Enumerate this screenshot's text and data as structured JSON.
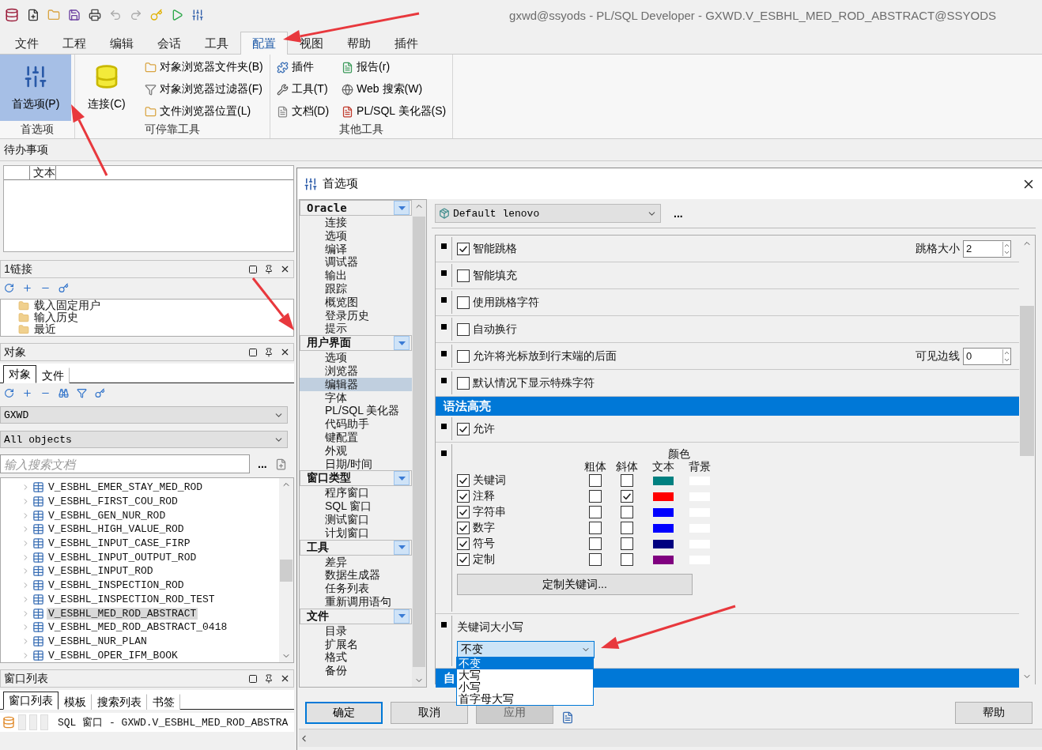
{
  "app": {
    "title": "gxwd@ssyods - PL/SQL Developer - GXWD.V_ESBHL_MED_ROD_ABSTRACT@SSYODS"
  },
  "menu_tabs": [
    {
      "label": "文件",
      "selected": false
    },
    {
      "label": "工程",
      "selected": false
    },
    {
      "label": "编辑",
      "selected": false
    },
    {
      "label": "会话",
      "selected": false
    },
    {
      "label": "工具",
      "selected": false
    },
    {
      "label": "配置",
      "selected": true
    },
    {
      "label": "视图",
      "selected": false
    },
    {
      "label": "帮助",
      "selected": false
    },
    {
      "label": "插件",
      "selected": false
    }
  ],
  "ribbon": {
    "groups": [
      {
        "label": "首选项",
        "large": [
          {
            "label": "首选项(P)",
            "selected": true
          }
        ]
      },
      {
        "label": "可停靠工具",
        "large": [
          {
            "label": "连接(C)",
            "selected": false
          }
        ],
        "small": [
          "对象浏览器文件夹(B)",
          "对象浏览器过滤器(F)",
          "文件浏览器位置(L)"
        ]
      },
      {
        "label": "其他工具",
        "small": [
          "插件",
          "工具(T)",
          "文档(D)",
          "报告(r)",
          "Web 搜索(W)",
          "PL/SQL 美化器(S)"
        ]
      }
    ]
  },
  "todo": {
    "title": "待办事项",
    "columns": [
      "文本"
    ]
  },
  "connections": {
    "title": "1链接",
    "tree": [
      "载入固定用户",
      "输入历史",
      "最近"
    ]
  },
  "objects": {
    "title": "对象",
    "tabs": [
      {
        "label": "对象",
        "selected": true
      },
      {
        "label": "文件",
        "selected": false
      }
    ],
    "user": "GXWD",
    "filter": "All objects",
    "search": {
      "placeholder": "输入搜索文档"
    },
    "more": "...",
    "items": [
      {
        "label": "V_ESBHL_EMER_STAY_MED_ROD",
        "selected": false
      },
      {
        "label": "V_ESBHL_FIRST_COU_ROD",
        "selected": false
      },
      {
        "label": "V_ESBHL_GEN_NUR_ROD",
        "selected": false
      },
      {
        "label": "V_ESBHL_HIGH_VALUE_ROD",
        "selected": false
      },
      {
        "label": "V_ESBHL_INPUT_CASE_FIRP",
        "selected": false
      },
      {
        "label": "V_ESBHL_INPUT_OUTPUT_ROD",
        "selected": false
      },
      {
        "label": "V_ESBHL_INPUT_ROD",
        "selected": false
      },
      {
        "label": "V_ESBHL_INSPECTION_ROD",
        "selected": false
      },
      {
        "label": "V_ESBHL_INSPECTION_ROD_TEST",
        "selected": false
      },
      {
        "label": "V_ESBHL_MED_ROD_ABSTRACT",
        "selected": true
      },
      {
        "label": "V_ESBHL_MED_ROD_ABSTRACT_0418",
        "selected": false
      },
      {
        "label": "V_ESBHL_NUR_PLAN",
        "selected": false
      },
      {
        "label": "V_ESBHL_OPER_IFM_BOOK",
        "selected": false
      }
    ]
  },
  "window_list": {
    "title": "窗口列表",
    "tabs": [
      {
        "label": "窗口列表",
        "selected": true
      },
      {
        "label": "模板",
        "selected": false
      },
      {
        "label": "搜索列表",
        "selected": false
      },
      {
        "label": "书签",
        "selected": false
      }
    ],
    "items": [
      "SQL 窗口 - GXWD.V_ESBHL_MED_ROD_ABSTRA"
    ]
  },
  "dialog": {
    "title": "首选项",
    "categories": [
      {
        "label": "Oracle",
        "items": [
          {
            "label": "连接",
            "selected": false
          },
          {
            "label": "选项",
            "selected": false
          },
          {
            "label": "编译",
            "selected": false
          },
          {
            "label": "调试器",
            "selected": false
          },
          {
            "label": "输出",
            "selected": false
          },
          {
            "label": "跟踪",
            "selected": false
          },
          {
            "label": "概览图",
            "selected": false
          },
          {
            "label": "登录历史",
            "selected": false
          },
          {
            "label": "提示",
            "selected": false
          }
        ]
      },
      {
        "label": "用户界面",
        "items": [
          {
            "label": "选项",
            "selected": false
          },
          {
            "label": "浏览器",
            "selected": false
          },
          {
            "label": "编辑器",
            "selected": true
          },
          {
            "label": "字体",
            "selected": false
          },
          {
            "label": "PL/SQL 美化器",
            "selected": false
          },
          {
            "label": "代码助手",
            "selected": false
          },
          {
            "label": "键配置",
            "selected": false
          },
          {
            "label": "外观",
            "selected": false
          },
          {
            "label": "日期/时间",
            "selected": false
          }
        ]
      },
      {
        "label": "窗口类型",
        "items": [
          {
            "label": "程序窗口",
            "selected": false
          },
          {
            "label": "SQL 窗口",
            "selected": false
          },
          {
            "label": "测试窗口",
            "selected": false
          },
          {
            "label": "计划窗口",
            "selected": false
          }
        ]
      },
      {
        "label": "工具",
        "items": [
          {
            "label": "差异",
            "selected": false
          },
          {
            "label": "数据生成器",
            "selected": false
          },
          {
            "label": "任务列表",
            "selected": false
          },
          {
            "label": "重新调用语句",
            "selected": false
          }
        ]
      },
      {
        "label": "文件",
        "items": [
          {
            "label": "目录",
            "selected": false
          },
          {
            "label": "扩展名",
            "selected": false
          },
          {
            "label": "格式",
            "selected": false
          },
          {
            "label": "备份",
            "selected": false
          }
        ]
      }
    ],
    "profile": "Default lenovo",
    "profile_more": "...",
    "rows": [
      {
        "kind": "option",
        "label": "智能跳格",
        "checked": true,
        "spin": {
          "label": "跳格大小",
          "value": "2"
        }
      },
      {
        "kind": "option",
        "label": "智能填充",
        "checked": false
      },
      {
        "kind": "option",
        "label": "使用跳格字符",
        "checked": false
      },
      {
        "kind": "option",
        "label": "自动换行",
        "checked": false
      },
      {
        "kind": "option",
        "label": "允许将光标放到行末端的后面",
        "checked": false,
        "spin": {
          "label": "可见边线",
          "value": "0"
        }
      },
      {
        "kind": "option",
        "label": "默认情况下显示特殊字符",
        "checked": false
      },
      {
        "kind": "header",
        "label": "语法高亮"
      },
      {
        "kind": "option",
        "label": "允许",
        "checked": true
      },
      {
        "kind": "syntax",
        "headers": {
          "bold_label": "粗体",
          "italic_label": "斜体",
          "colour_label": "颜色",
          "text_label": "文本",
          "bg_label": "背景"
        },
        "button": "定制关键词...",
        "items": [
          {
            "label": "关键词",
            "checked": true,
            "bold": false,
            "italic": false,
            "color": "#008080",
            "background": {
              "color": "#ffffff"
            }
          },
          {
            "label": "注释",
            "checked": true,
            "bold": false,
            "italic": true,
            "color": "#ff0000",
            "background": {
              "color": "#ffffff"
            }
          },
          {
            "label": "字符串",
            "checked": true,
            "bold": false,
            "italic": false,
            "color": "#0000ff",
            "background": {
              "color": "#ffffff"
            }
          },
          {
            "label": "数字",
            "checked": true,
            "bold": false,
            "italic": false,
            "color": "#0000ff",
            "background": {
              "color": "#ffffff"
            }
          },
          {
            "label": "符号",
            "checked": true,
            "bold": false,
            "italic": false,
            "color": "#000080",
            "background": {
              "color": "#ffffff"
            }
          },
          {
            "label": "定制",
            "checked": true,
            "bold": false,
            "italic": false,
            "color": "#800080",
            "background": {
              "color": "#ffffff"
            }
          }
        ]
      },
      {
        "kind": "keyword_case",
        "label": "关键词大小写",
        "value": "不变",
        "options": [
          {
            "label": "不变",
            "selected": true
          },
          {
            "label": "大写",
            "selected": false
          },
          {
            "label": "小写",
            "selected": false
          },
          {
            "label": "首字母大写",
            "selected": false
          }
        ]
      },
      {
        "kind": "header",
        "label": "自"
      }
    ],
    "buttons": [
      {
        "label": "确定",
        "kind": "default",
        "disabled": false
      },
      {
        "label": "取消",
        "kind": "normal",
        "disabled": false
      },
      {
        "label": "应用",
        "kind": "normal",
        "disabled": true
      },
      {
        "label": "帮助",
        "kind": "help",
        "disabled": false
      }
    ]
  }
}
